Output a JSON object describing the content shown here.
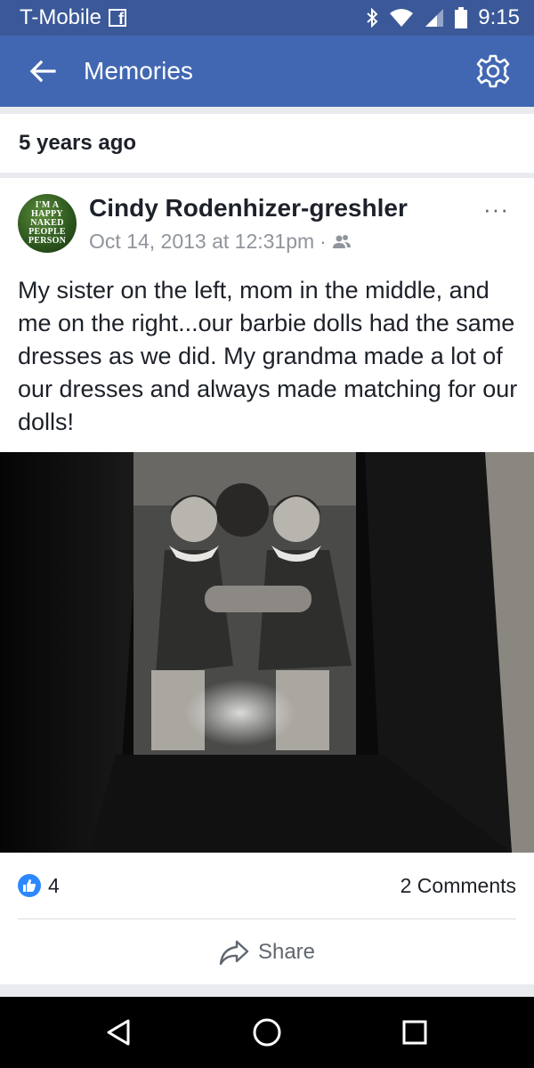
{
  "status_bar": {
    "carrier": "T-Mobile",
    "carrier_badge": "f",
    "time": "9:15",
    "icons": [
      "facebook-icon",
      "bluetooth-icon",
      "wifi-icon",
      "signal-icon",
      "battery-icon"
    ]
  },
  "app_bar": {
    "title": "Memories",
    "back_icon": "arrow-left-icon",
    "settings_icon": "gear-icon",
    "color": "#4267b2",
    "status_color": "#3b5998"
  },
  "section": {
    "label": "5 years ago"
  },
  "post": {
    "author": "Cindy Rodenhizer-greshler",
    "avatar_text": [
      "I'M A",
      "HAPPY",
      "NAKED",
      "PEOPLE",
      "PERSON"
    ],
    "timestamp": "Oct 14, 2013 at 12:31pm",
    "separator": "·",
    "audience_icon": "friends-icon",
    "more_label": "···",
    "text": "My sister on the left, mom in the middle, and me on the right...our barbie dolls had the same dresses as we did.  My grandma made a lot of our dresses and always made matching for our dolls!",
    "likes": "4",
    "like_color": "#2d88ff",
    "comments_label": "2 Comments",
    "share_label": "Share"
  },
  "nav_bar": {
    "icons": [
      "back-triangle-icon",
      "home-circle-icon",
      "recents-square-icon"
    ]
  }
}
